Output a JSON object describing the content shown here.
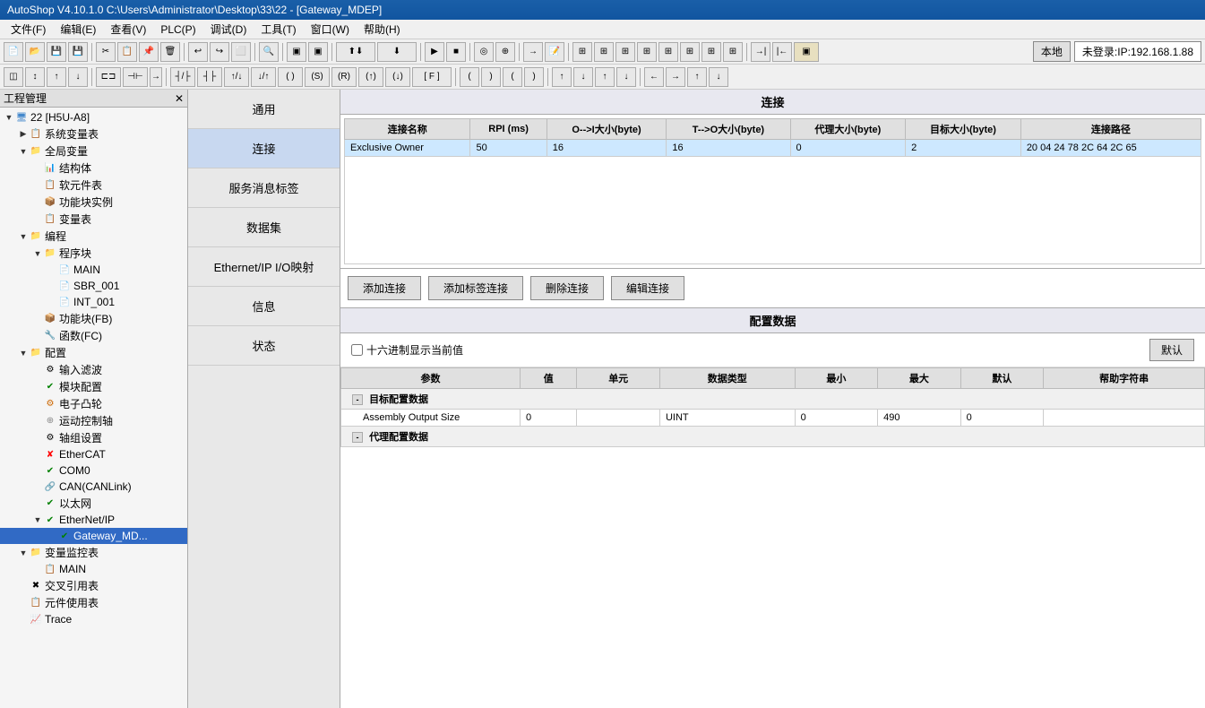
{
  "titlebar": {
    "text": "AutoShop V4.10.1.0  C:\\Users\\Administrator\\Desktop\\33\\22 - [Gateway_MDEP]"
  },
  "menubar": {
    "items": [
      {
        "label": "文件(F)"
      },
      {
        "label": "编辑(E)"
      },
      {
        "label": "查看(V)"
      },
      {
        "label": "PLC(P)"
      },
      {
        "label": "调试(D)"
      },
      {
        "label": "工具(T)"
      },
      {
        "label": "窗口(W)"
      },
      {
        "label": "帮助(H)"
      }
    ]
  },
  "toolbar": {
    "local_button": "本地",
    "ip_label": "未登录:IP:192.168.1.88"
  },
  "project_panel": {
    "header": "工程管理",
    "tree": [
      {
        "id": "root",
        "label": "22 [H5U-A8]",
        "indent": 0,
        "icon": "pc",
        "expanded": true
      },
      {
        "id": "sysvars",
        "label": "系统变量表",
        "indent": 1,
        "icon": "table",
        "expanded": false
      },
      {
        "id": "globalvars",
        "label": "全局变量",
        "indent": 1,
        "icon": "folder",
        "expanded": true
      },
      {
        "id": "struct",
        "label": "结构体",
        "indent": 2,
        "icon": "struct"
      },
      {
        "id": "softelem",
        "label": "软元件表",
        "indent": 2,
        "icon": "table"
      },
      {
        "id": "fbinst",
        "label": "功能块实例",
        "indent": 2,
        "icon": "fb"
      },
      {
        "id": "varlist",
        "label": "变量表",
        "indent": 2,
        "icon": "list"
      },
      {
        "id": "prog",
        "label": "编程",
        "indent": 1,
        "icon": "folder",
        "expanded": true
      },
      {
        "id": "progblocks",
        "label": "程序块",
        "indent": 2,
        "icon": "folder",
        "expanded": true
      },
      {
        "id": "main",
        "label": "MAIN",
        "indent": 3,
        "icon": "prog"
      },
      {
        "id": "sbr001",
        "label": "SBR_001",
        "indent": 3,
        "icon": "prog"
      },
      {
        "id": "int001",
        "label": "INT_001",
        "indent": 3,
        "icon": "prog"
      },
      {
        "id": "fb",
        "label": "功能块(FB)",
        "indent": 2,
        "icon": "fb"
      },
      {
        "id": "fc",
        "label": "函数(FC)",
        "indent": 2,
        "icon": "fc"
      },
      {
        "id": "config",
        "label": "配置",
        "indent": 1,
        "icon": "folder",
        "expanded": true
      },
      {
        "id": "inputfilter",
        "label": "输入滤波",
        "indent": 2,
        "icon": "filter"
      },
      {
        "id": "moduleconfig",
        "label": "模块配置",
        "indent": 2,
        "icon": "ok"
      },
      {
        "id": "eleccam",
        "label": "电子凸轮",
        "indent": 2,
        "icon": "cam"
      },
      {
        "id": "motionaxis",
        "label": "运动控制轴",
        "indent": 2,
        "icon": "axis"
      },
      {
        "id": "axisgroup",
        "label": "轴组设置",
        "indent": 2,
        "icon": "gear"
      },
      {
        "id": "ethercat",
        "label": "EtherCAT",
        "indent": 2,
        "icon": "error"
      },
      {
        "id": "com0",
        "label": "COM0",
        "indent": 2,
        "icon": "ok"
      },
      {
        "id": "canlink",
        "label": "CAN(CANLink)",
        "indent": 2,
        "icon": "canlink"
      },
      {
        "id": "ethernet",
        "label": "以太网",
        "indent": 2,
        "icon": "ok"
      },
      {
        "id": "ethernetip",
        "label": "EtherNet/IP",
        "indent": 2,
        "icon": "ok",
        "expanded": true
      },
      {
        "id": "gateway",
        "label": "Gateway_MD...",
        "indent": 3,
        "icon": "ok",
        "selected": true
      },
      {
        "id": "varmonitor",
        "label": "变量监控表",
        "indent": 1,
        "icon": "folder",
        "expanded": true
      },
      {
        "id": "mainmon",
        "label": "MAIN",
        "indent": 2,
        "icon": "table"
      },
      {
        "id": "crossref",
        "label": "交叉引用表",
        "indent": 1,
        "icon": "cross"
      },
      {
        "id": "elemuse",
        "label": "元件使用表",
        "indent": 1,
        "icon": "elem"
      },
      {
        "id": "trace",
        "label": "Trace",
        "indent": 1,
        "icon": "trace"
      }
    ]
  },
  "nav_panel": {
    "items": [
      {
        "label": "通用",
        "active": false
      },
      {
        "label": "连接",
        "active": true
      },
      {
        "label": "服务消息标签",
        "active": false
      },
      {
        "label": "数据集",
        "active": false
      },
      {
        "label": "Ethernet/IP I/O映射",
        "active": false
      },
      {
        "label": "信息",
        "active": false
      },
      {
        "label": "状态",
        "active": false
      }
    ]
  },
  "connection_section": {
    "header": "连接",
    "table_headers": [
      "连接名称",
      "RPI (ms)",
      "O-->I大小(byte)",
      "T-->O大小(byte)",
      "代理大小(byte)",
      "目标大小(byte)",
      "连接路径"
    ],
    "rows": [
      {
        "name": "Exclusive Owner",
        "rpi": "50",
        "o_to_i": "16",
        "t_to_o": "16",
        "proxy_size": "0",
        "target_size": "2",
        "path": "20 04 24 78 2C 64 2C 65"
      }
    ],
    "buttons": [
      "添加连接",
      "添加标签连接",
      "删除连接",
      "编辑连接"
    ]
  },
  "config_section": {
    "header": "配置数据",
    "hex_label": "十六进制显示当前值",
    "default_btn": "默认",
    "table_headers": [
      "参数",
      "值",
      "单元",
      "数据类型",
      "最小",
      "最大",
      "默认",
      "帮助字符串"
    ],
    "groups": [
      {
        "name": "目标配置数据",
        "rows": [
          {
            "param": "Assembly Output Size",
            "value": "0",
            "unit": "",
            "dtype": "UINT",
            "min": "0",
            "max": "490",
            "default": "0",
            "help": ""
          }
        ]
      },
      {
        "name": "代理配置数据",
        "rows": []
      }
    ]
  }
}
